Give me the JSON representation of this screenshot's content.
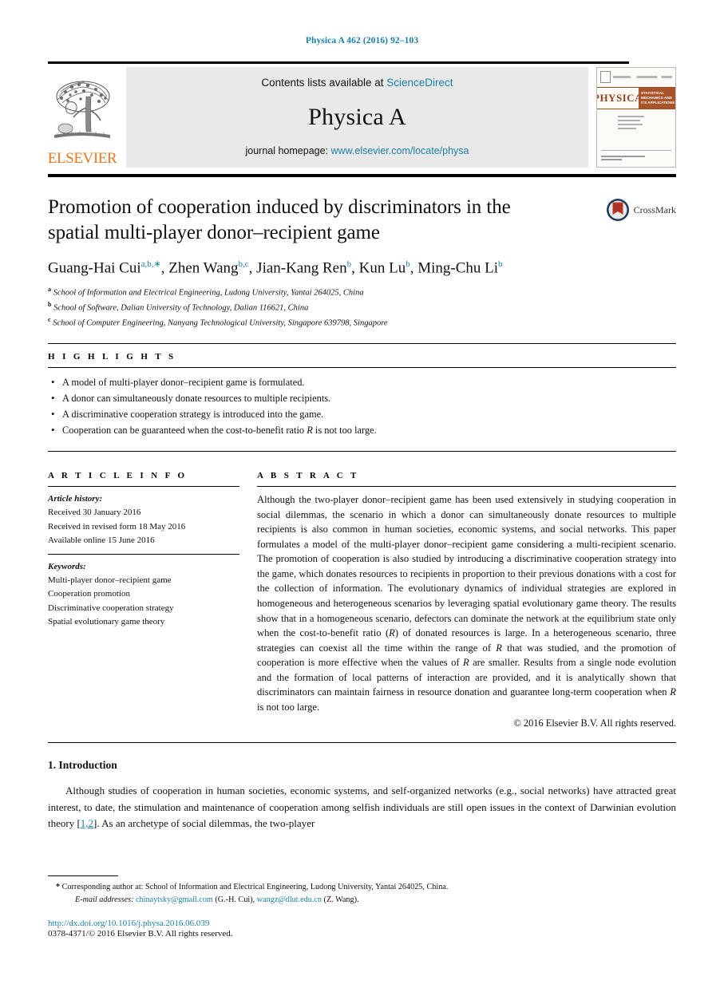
{
  "running_head": "Physica A 462 (2016) 92–103",
  "masthead": {
    "contents_prefix": "Contents lists available at",
    "contents_link": "ScienceDirect",
    "journal_name": "Physica A",
    "homepage_prefix": "journal homepage:",
    "homepage_link": "www.elsevier.com/locate/physa",
    "publisher_wordmark": "ELSEVIER",
    "cover": {
      "banner_title": "PHYSICA",
      "banner_subtitle": "STATISTICAL MECHANICS AND ITS APPLICATIONS"
    }
  },
  "article": {
    "title": "Promotion of cooperation induced by discriminators in the spatial multi-player donor–recipient game",
    "crossmark_label": "CrossMark",
    "authors": [
      {
        "name": "Guang-Hai Cui",
        "sup": "a,b,∗"
      },
      {
        "name": "Zhen Wang",
        "sup": "b,c"
      },
      {
        "name": "Jian-Kang Ren",
        "sup": "b"
      },
      {
        "name": "Kun Lu",
        "sup": "b"
      },
      {
        "name": "Ming-Chu Li",
        "sup": "b"
      }
    ],
    "affiliations": [
      {
        "marker": "a",
        "text": "School of Information and Electrical Engineering, Ludong University, Yantai 264025, China"
      },
      {
        "marker": "b",
        "text": "School of Software, Dalian University of Technology, Dalian 116621, China"
      },
      {
        "marker": "c",
        "text": "School of Computer Engineering, Nanyang Technological University, Singapore 639798, Singapore"
      }
    ]
  },
  "highlights": {
    "heading": "H I G H L I G H T S",
    "items": [
      "A model of multi-player donor–recipient game is formulated.",
      "A donor can simultaneously donate resources to multiple recipients.",
      "A discriminative cooperation strategy is introduced into the game.",
      "Cooperation can be guaranteed when the cost-to-benefit ratio R is not too large."
    ]
  },
  "article_info": {
    "heading": "A R T I C L E    I N F O",
    "history_label": "Article history:",
    "history": [
      "Received 30 January 2016",
      "Received in revised form 18 May 2016",
      "Available online 15 June 2016"
    ],
    "keywords_label": "Keywords:",
    "keywords": [
      "Multi-player donor–recipient game",
      "Cooperation promotion",
      "Discriminative cooperation strategy",
      "Spatial evolutionary game theory"
    ]
  },
  "abstract": {
    "heading": "A B S T R A C T",
    "text": "Although the two-player donor–recipient game has been used extensively in studying cooperation in social dilemmas, the scenario in which a donor can simultaneously donate resources to multiple recipients is also common in human societies, economic systems, and social networks. This paper formulates a model of the multi-player donor–recipient game considering a multi-recipient scenario. The promotion of cooperation is also studied by introducing a discriminative cooperation strategy into the game, which donates resources to recipients in proportion to their previous donations with a cost for the collection of information. The evolutionary dynamics of individual strategies are explored in homogeneous and heterogeneous scenarios by leveraging spatial evolutionary game theory. The results show that in a homogeneous scenario, defectors can dominate the network at the equilibrium state only when the cost-to-benefit ratio (R) of donated resources is large. In a heterogeneous scenario, three strategies can coexist all the time within the range of R that was studied, and the promotion of cooperation is more effective when the values of R are smaller. Results from a single node evolution and the formation of local patterns of interaction are provided, and it is analytically shown that discriminators can maintain fairness in resource donation and guarantee long-term cooperation when R is not too large.",
    "copyright": "© 2016 Elsevier B.V. All rights reserved."
  },
  "introduction": {
    "heading": "1.  Introduction",
    "paragraph_part1": "Although studies of cooperation in human societies, economic systems, and self-organized networks (e.g., social networks) have attracted great interest, to date, the stimulation and maintenance of cooperation among selfish individuals are still open issues in the context of Darwinian evolution theory [",
    "reference": "1,2",
    "paragraph_part2": "]. As an archetype of social dilemmas, the two-player"
  },
  "footnotes": {
    "corresponding": "Corresponding author at: School of Information and Electrical Engineering, Ludong University, Yantai 264025, China.",
    "email_label": "E-mail addresses:",
    "emails": [
      {
        "address": "chinaytsky@gmail.com",
        "owner": "(G.-H. Cui)"
      },
      {
        "address": "wangz@dlut.edu.cn",
        "owner": "(Z. Wang)"
      }
    ],
    "doi": "http://dx.doi.org/10.1016/j.physa.2016.06.039",
    "issn": "0378-4371/© 2016 Elsevier B.V. All rights reserved."
  },
  "colors": {
    "link": "#1a7fa8",
    "elsevier_orange": "#E87722",
    "cover_brown": "#a85329"
  }
}
